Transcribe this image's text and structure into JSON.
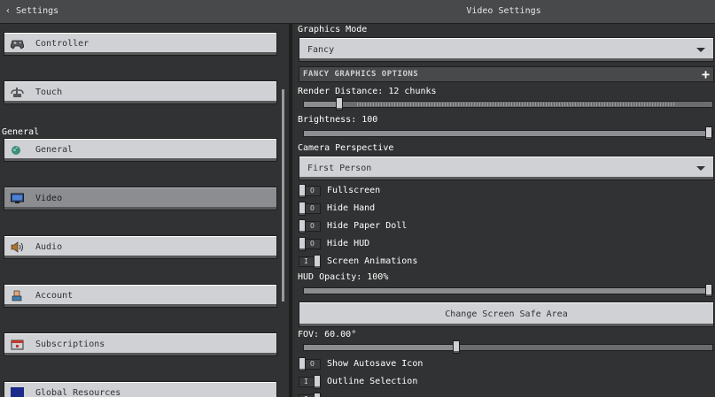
{
  "header": {
    "back_label": "‹ Settings",
    "title": "Video Settings"
  },
  "sidebar": {
    "section_general": "General",
    "items": [
      {
        "label": "Controller",
        "icon": "controller-icon"
      },
      {
        "label": "Touch",
        "icon": "touch-icon"
      },
      {
        "label": "General",
        "icon": "globe-icon"
      },
      {
        "label": "Video",
        "icon": "monitor-icon",
        "selected": true
      },
      {
        "label": "Audio",
        "icon": "speaker-icon"
      },
      {
        "label": "Account",
        "icon": "account-icon"
      },
      {
        "label": "Subscriptions",
        "icon": "subscriptions-icon"
      },
      {
        "label": "Global Resources",
        "icon": "global-resources-icon"
      }
    ]
  },
  "main": {
    "graphics_mode_label": "Graphics Mode",
    "graphics_mode_value": "Fancy",
    "fancy_options_header": "FANCY GRAPHICS OPTIONS",
    "render_distance_label": "Render Distance: 12 chunks",
    "render_distance_fraction": 0.08,
    "brightness_label": "Brightness: 100",
    "brightness_fraction": 1.0,
    "camera_perspective_label": "Camera Perspective",
    "camera_perspective_value": "First Person",
    "toggles": [
      {
        "label": "Fullscreen",
        "on": false
      },
      {
        "label": "Hide Hand",
        "on": false
      },
      {
        "label": "Hide Paper Doll",
        "on": false
      },
      {
        "label": "Hide HUD",
        "on": false
      },
      {
        "label": "Screen Animations",
        "on": true
      }
    ],
    "hud_opacity_label": "HUD Opacity: 100%",
    "hud_opacity_fraction": 1.0,
    "safe_area_button": "Change Screen Safe Area",
    "fov_label": "FOV: 60.00°",
    "fov_fraction": 0.37,
    "toggles2": [
      {
        "label": "Show Autosave Icon",
        "on": false
      },
      {
        "label": "Outline Selection",
        "on": true
      }
    ]
  },
  "colors": {
    "background": "#313233",
    "button": "#d0d1d4",
    "selected": "#8c8d90",
    "header": "#48494a"
  }
}
